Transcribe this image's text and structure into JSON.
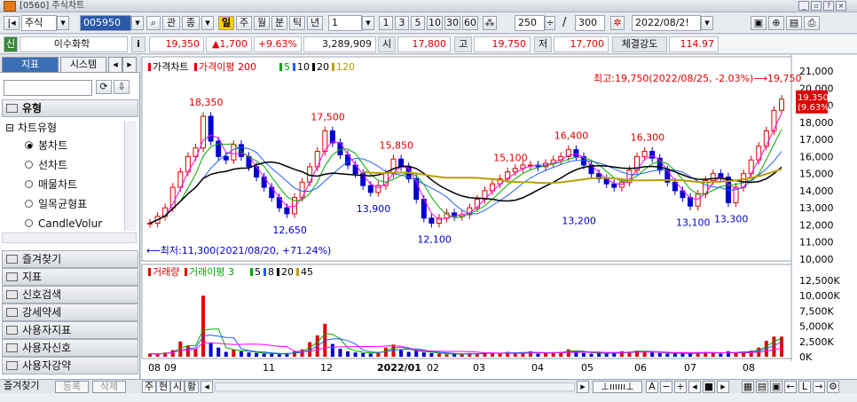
{
  "window": {
    "title": "[0560] 주식차트"
  },
  "toolbar": {
    "market": "주식",
    "code": "005950",
    "mode_labels": [
      "관",
      "종"
    ],
    "period_active": "일",
    "periods": [
      "주",
      "월",
      "분",
      "틱",
      "년"
    ],
    "unit_value": "1",
    "quick_units": [
      "1",
      "3",
      "5",
      "10",
      "30",
      "60"
    ],
    "count": "250",
    "total": "300",
    "date": "2022/08/2!"
  },
  "info": {
    "badge": "신",
    "name": "이수화학",
    "info_btn": "i",
    "price": "19,350",
    "change": "▲1,700",
    "change_pct": "+9.63%",
    "volume": "3,289,909",
    "open_label": "시",
    "open": "17,800",
    "high_label": "고",
    "high": "19,750",
    "low_label": "저",
    "low": "17,700",
    "strength_label": "체결강도",
    "strength": "114.97"
  },
  "left": {
    "tab_indicator": "지표",
    "tab_system": "시스템",
    "section_type": "유형",
    "tree_root": "차트유형",
    "chart_types": [
      "봉차트",
      "선차트",
      "매물차트",
      "일목균형표",
      "CandleVolur"
    ],
    "selected_type": 0,
    "sections": [
      "즐겨찾기",
      "지표",
      "신호검색",
      "강세약세",
      "사용자지표",
      "사용자신호",
      "사용자강약"
    ]
  },
  "bottom": {
    "fav_label": "즐겨찾기",
    "register": "등록",
    "delete": "삭제",
    "tabs": [
      "주",
      "현",
      "시",
      "황"
    ]
  },
  "chart_data": [
    {
      "type": "line",
      "title": "가격차트",
      "legend": [
        "가격차트",
        "가격이평 200",
        "5",
        "10",
        "20",
        "120"
      ],
      "colors": {
        "price_up": "#e00000",
        "price_down": "#0000d0",
        "ma5": "#ff00ff",
        "ma10": "#00aa00",
        "ma20": "#2060ff",
        "ma120": "#000000",
        "ma200": "#b8a000"
      },
      "x_labels": [
        "08",
        "09",
        "11",
        "12",
        "2022/01",
        "02",
        "03",
        "04",
        "05",
        "06",
        "07",
        "08"
      ],
      "ylim": [
        10000,
        21000
      ],
      "y_ticks": [
        10000,
        11000,
        12000,
        13000,
        14000,
        15000,
        16000,
        17000,
        18000,
        19000,
        20000,
        21000
      ],
      "y_tick_labels": [
        "10,000",
        "11,000",
        "12,000",
        "13,000",
        "14,000",
        "15,000",
        "16,000",
        "17,000",
        "18,000",
        "19,000",
        "20,000",
        "21,000"
      ],
      "close": [
        12100,
        12500,
        13000,
        14200,
        15100,
        16000,
        16500,
        18350,
        16900,
        16000,
        15800,
        16700,
        16000,
        15400,
        14800,
        14200,
        13600,
        13000,
        12650,
        13600,
        14500,
        15400,
        16300,
        17500,
        16800,
        16100,
        15500,
        15000,
        14300,
        13900,
        14300,
        15000,
        15850,
        15400,
        14700,
        13500,
        12400,
        12100,
        12400,
        12700,
        12500,
        12600,
        13000,
        13500,
        14000,
        14400,
        14700,
        15100,
        15300,
        15500,
        15500,
        15400,
        15600,
        15800,
        16000,
        16400,
        16000,
        15500,
        15000,
        14700,
        14400,
        14200,
        14500,
        15200,
        16000,
        16300,
        15900,
        15200,
        14500,
        14000,
        13600,
        13100,
        13800,
        14600,
        15000,
        14800,
        13300,
        14200,
        15000,
        15800,
        16600,
        17500,
        18700,
        19350
      ],
      "annotations": [
        {
          "label": "18,350",
          "value": 18350
        },
        {
          "label": "17,500",
          "value": 17500
        },
        {
          "label": "15,850",
          "value": 15850
        },
        {
          "label": "15,100",
          "value": 15100
        },
        {
          "label": "16,400",
          "value": 16400
        },
        {
          "label": "16,300",
          "value": 16300
        },
        {
          "label": "19,750",
          "value": 19750
        },
        {
          "label": "12,650",
          "value": 12650
        },
        {
          "label": "13,900",
          "value": 13900
        },
        {
          "label": "12,100",
          "value": 12100
        },
        {
          "label": "13,200",
          "value": 13200
        },
        {
          "label": "13,100",
          "value": 13100
        },
        {
          "label": "13,300",
          "value": 13300
        }
      ],
      "high_note": "최고:19,750(2022/08/25, -2.03%)⟶",
      "low_note": "⟵최저:11,300(2021/08/20, +71.24%)",
      "current_price": "19,350",
      "current_pct": "(9.63%)"
    },
    {
      "type": "bar",
      "title": "거래량",
      "legend": [
        "거래량",
        "거래이평 3",
        "5",
        "8",
        "20",
        "45"
      ],
      "ylim": [
        0,
        12500000
      ],
      "y_ticks": [
        0,
        2500000,
        5000000,
        7500000,
        10000000,
        12500000
      ],
      "y_tick_labels": [
        "0K",
        "2,500K",
        "5,000K",
        "7,500K",
        "10,000K",
        "12,500K"
      ],
      "values": [
        500,
        400,
        700,
        1100,
        2500,
        1800,
        1300,
        10000,
        2200,
        1500,
        800,
        1200,
        900,
        700,
        600,
        500,
        500,
        400,
        600,
        900,
        1200,
        2400,
        3500,
        5400,
        2100,
        1300,
        900,
        700,
        600,
        500,
        800,
        1500,
        2000,
        1100,
        800,
        1000,
        700,
        600,
        500,
        400,
        500,
        400,
        600,
        500,
        700,
        600,
        500,
        800,
        600,
        700,
        900,
        500,
        600,
        700,
        800,
        1200,
        900,
        600,
        500,
        700,
        500,
        600,
        900,
        800,
        1000,
        900,
        700,
        600,
        500,
        500,
        600,
        500,
        700,
        800,
        600,
        500,
        900,
        700,
        800,
        1000,
        1500,
        2600,
        3300,
        3290
      ]
    }
  ]
}
